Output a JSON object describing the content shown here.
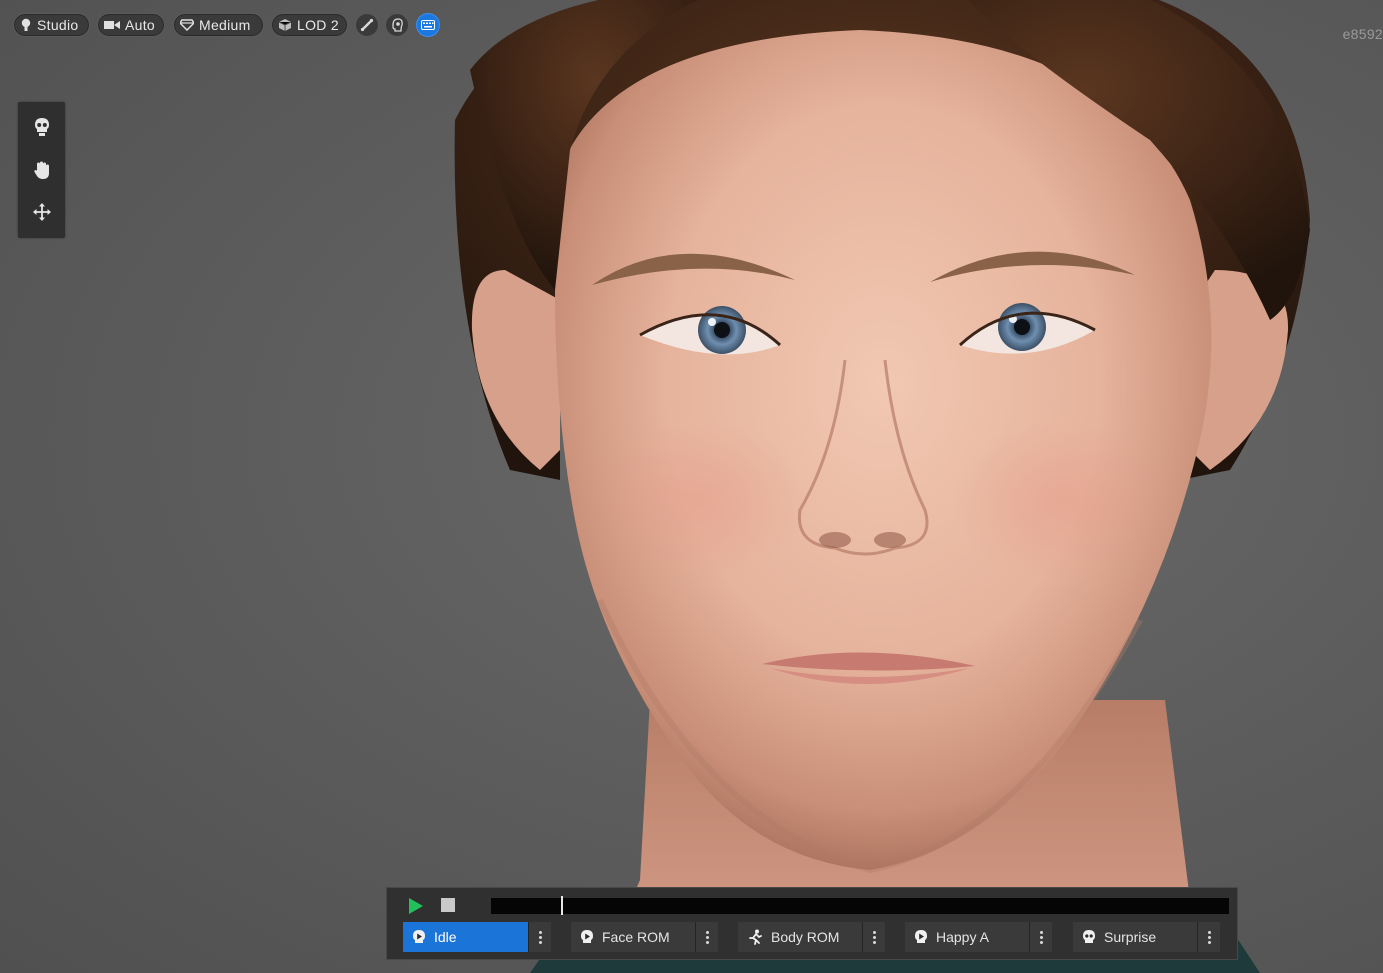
{
  "toolbar": {
    "lighting": {
      "label": "Studio",
      "icon": "light-bulb-icon"
    },
    "camera": {
      "label": "Auto",
      "icon": "camera-icon"
    },
    "quality": {
      "label": "Medium",
      "icon": "gem-icon"
    },
    "lod": {
      "label": "LOD 2",
      "icon": "cube-icon"
    },
    "icons": [
      "bone-icon",
      "head-outline-icon",
      "keyboard-icon"
    ],
    "active_color": "#1a78e0"
  },
  "watermark": "e8592",
  "tools": [
    "skull-icon",
    "hand-pan-icon",
    "move-arrows-icon"
  ],
  "animation_panel": {
    "progress": 0.095,
    "items": [
      {
        "label": "Idle",
        "icon": "play-head-icon",
        "selected": true
      },
      {
        "label": "Face ROM",
        "icon": "play-head-icon",
        "selected": false
      },
      {
        "label": "Body ROM",
        "icon": "running-figure-icon",
        "selected": false
      },
      {
        "label": "Happy A",
        "icon": "play-head-icon",
        "selected": false
      },
      {
        "label": "Surprise",
        "icon": "skull-icon",
        "selected": false
      }
    ],
    "selected_color": "#1b74d8",
    "play_color": "#22c05a"
  }
}
